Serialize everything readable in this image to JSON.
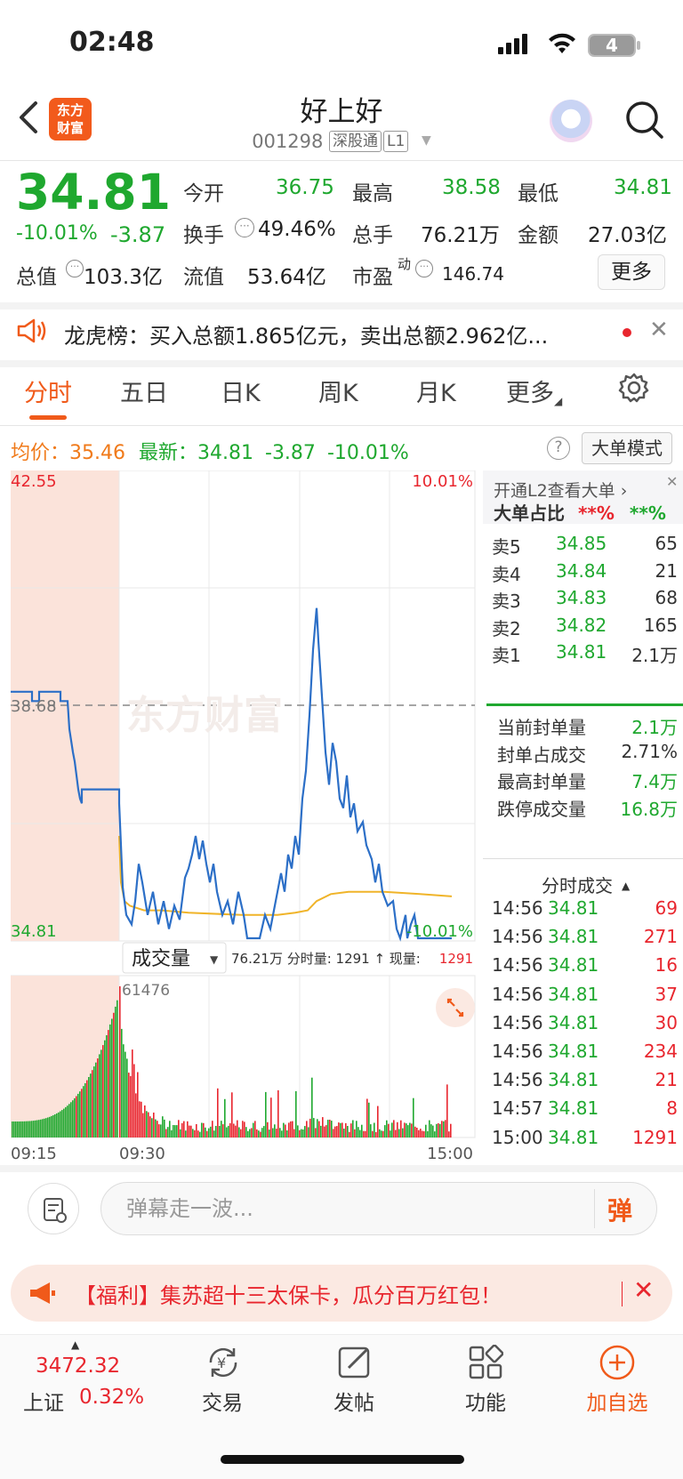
{
  "status": {
    "time": "02:48",
    "battery": "4"
  },
  "header": {
    "logo": "东方\n财富",
    "name": "好上好",
    "code": "001298",
    "tag1": "深股通",
    "tag2": "L1"
  },
  "quote": {
    "price": "34.81",
    "pct": "-10.01%",
    "chg": "-3.87",
    "open_label": "今开",
    "open": "36.75",
    "high_label": "最高",
    "high": "38.58",
    "low_label": "最低",
    "low": "34.81",
    "turnover_label": "换手",
    "turnover": "49.46%",
    "vol_label": "总手",
    "vol": "76.21万",
    "amount_label": "金额",
    "amount": "27.03亿",
    "mcap_label": "总值",
    "mcap": "103.3亿",
    "float_label": "流值",
    "float": "53.64亿",
    "pe_label": "市盈",
    "pe_sup": "动",
    "pe": "146.74",
    "more": "更多"
  },
  "dragon_tiger": {
    "text": "龙虎榜：买入总额1.865亿元，卖出总额2.962亿..."
  },
  "tabs": [
    "分时",
    "五日",
    "日K",
    "周K",
    "月K",
    "更多"
  ],
  "lineinfo": {
    "avg_label": "均价：",
    "avg": "35.46",
    "last_label": "最新：",
    "last": "34.81",
    "chg": "-3.87",
    "pct": "-10.01%",
    "help": "?",
    "mode": "大单模式"
  },
  "chart": {
    "price_top": "42.55",
    "price_mid": "38.68",
    "price_bottom": "34.81",
    "pct_top": "10.01%",
    "pct_bottom": "-10.01%",
    "vol_label": "成交量",
    "vol_info": "76.21万  分时量: 1291 ↑  现量:",
    "vol_now": "1291",
    "vol_max": "61476",
    "time_start": "09:15",
    "time_open": "09:30",
    "time_end": "15:00",
    "watermark": "东方财富",
    "colors": {
      "price_line": "#2c6fc7",
      "avg_line": "#f0b429",
      "up": "#e8262e",
      "down": "#1fa82f"
    }
  },
  "right_panel": {
    "l2": "开通L2查看大单 ›",
    "big_ratio_label": "大单占比",
    "big_red": "**%",
    "big_green": "**%",
    "asks": [
      {
        "label": "卖5",
        "price": "34.85",
        "vol": "65"
      },
      {
        "label": "卖4",
        "price": "34.84",
        "vol": "21"
      },
      {
        "label": "卖3",
        "price": "34.83",
        "vol": "68"
      },
      {
        "label": "卖2",
        "price": "34.82",
        "vol": "165"
      },
      {
        "label": "卖1",
        "price": "34.81",
        "vol": "2.1万"
      }
    ],
    "seal": [
      {
        "label": "当前封单量",
        "value": "2.1万"
      },
      {
        "label": "封单占成交",
        "value": "2.71%"
      },
      {
        "label": "最高封单量",
        "value": "7.4万"
      },
      {
        "label": "跌停成交量",
        "value": "16.8万"
      }
    ],
    "ticks_title": "分时成交",
    "ticks": [
      {
        "time": "14:56",
        "price": "34.81",
        "vol": "69"
      },
      {
        "time": "14:56",
        "price": "34.81",
        "vol": "271"
      },
      {
        "time": "14:56",
        "price": "34.81",
        "vol": "16"
      },
      {
        "time": "14:56",
        "price": "34.81",
        "vol": "37"
      },
      {
        "time": "14:56",
        "price": "34.81",
        "vol": "30"
      },
      {
        "time": "14:56",
        "price": "34.81",
        "vol": "234"
      },
      {
        "time": "14:56",
        "price": "34.81",
        "vol": "21"
      },
      {
        "time": "14:57",
        "price": "34.81",
        "vol": "8"
      },
      {
        "time": "15:00",
        "price": "34.81",
        "vol": "1291"
      }
    ]
  },
  "input": {
    "placeholder": "弹幕走一波...",
    "danmu": "弹"
  },
  "promo": {
    "text": "【福利】集苏超十三太保卡，瓜分百万红包！"
  },
  "nav": {
    "index_value": "3472.32",
    "index_name": "上证",
    "index_pct": "0.32%",
    "trade": "交易",
    "post": "发帖",
    "func": "功能",
    "watch": "加自选"
  }
}
